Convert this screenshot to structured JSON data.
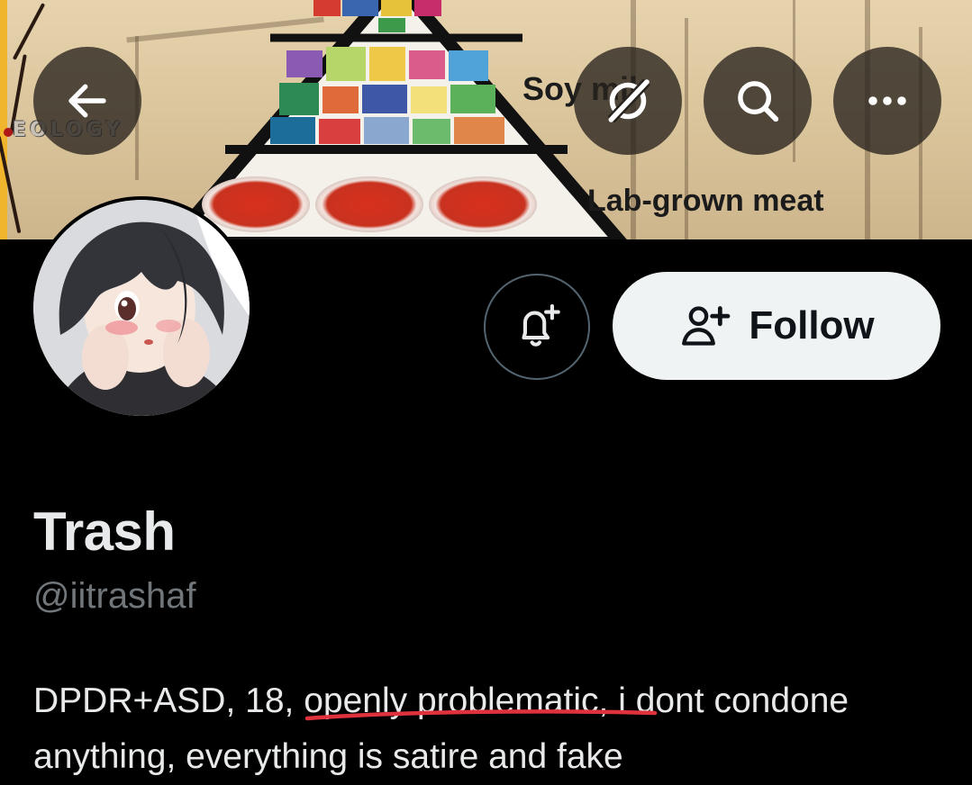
{
  "banner": {
    "brand_tag": "EOLOGY",
    "label_soy": "Soy mil",
    "label_meat": "Lab-grown meat"
  },
  "topbar": {
    "back_icon": "arrow-left-icon",
    "grok_icon": "grok-icon",
    "search_icon": "search-icon",
    "more_icon": "more-horizontal-icon"
  },
  "actions": {
    "notify_icon": "bell-plus-icon",
    "follow_icon": "person-add-icon",
    "follow_label": "Follow"
  },
  "profile": {
    "display_name": "Trash",
    "handle": "@iitrashaf",
    "bio": {
      "part1": "DPDR+ASD, 18, ",
      "highlight": "openly problematic,",
      "part2": " i dont condone anything, everything is satire and fake"
    }
  },
  "colors": {
    "background": "#000000",
    "primary_text": "#e7e9ea",
    "secondary_text": "#71767b",
    "follow_bg": "#eff3f4",
    "annotation_red": "#e0323c"
  }
}
